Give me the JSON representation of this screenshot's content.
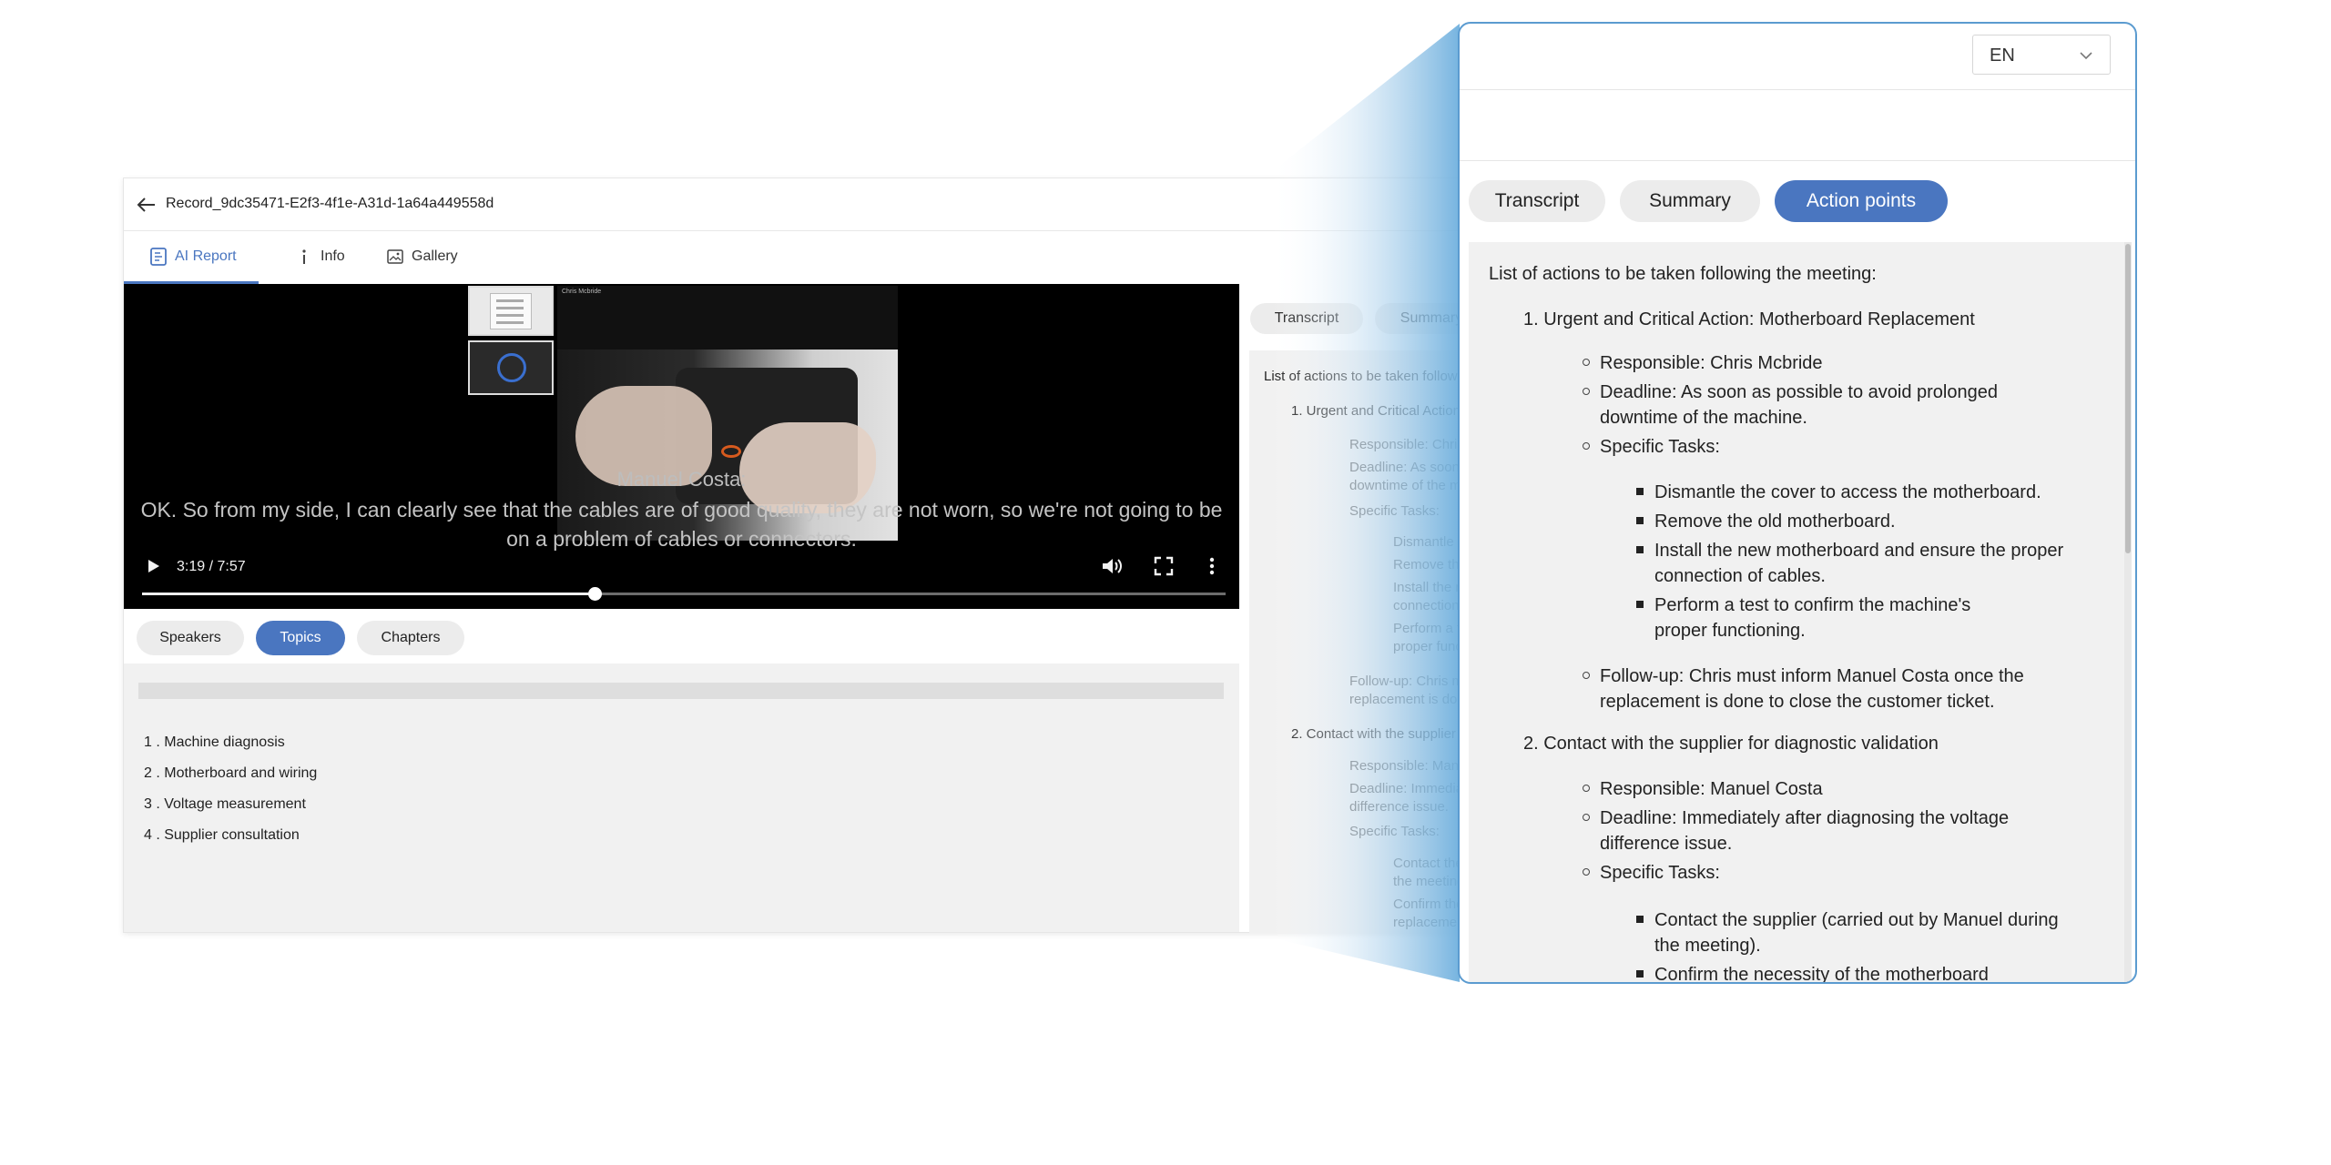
{
  "record": {
    "title": "Record_9dc35471-E2f3-4f1e-A31d-1a64a449558d"
  },
  "main_tabs": [
    {
      "label": "AI Report",
      "icon": "ai-report-icon",
      "active": true
    },
    {
      "label": "Info",
      "icon": "info-icon",
      "active": false
    },
    {
      "label": "Gallery",
      "icon": "image-icon",
      "active": false
    }
  ],
  "video": {
    "camera_label": "Chris Mcbride",
    "caption_speaker": "Manuel Costa:",
    "caption_text_1": "OK. So from my side, I can clearly see that the cables are of good quality, they are not worn, so we're not going to be",
    "caption_text_2": "on a problem of cables or connectors.",
    "time": "3:19 / 7:57",
    "progress": 0.4178
  },
  "sub_tabs": [
    {
      "label": "Speakers",
      "active": false
    },
    {
      "label": "Topics",
      "active": true
    },
    {
      "label": "Chapters",
      "active": false
    }
  ],
  "topics": [
    "1 . Machine diagnosis",
    "2 . Motherboard and wiring",
    "3 . Voltage measurement",
    "4 . Supplier consultation"
  ],
  "report_tabs": [
    {
      "label": "Transcript",
      "active": false
    },
    {
      "label": "Summary",
      "active": false
    },
    {
      "label": "Action points",
      "active": true
    }
  ],
  "language": {
    "selected": "EN"
  },
  "action_points": {
    "intro": "List of actions to be taken following the meeting:",
    "item1_title": "1. Urgent and Critical Action: Motherboard Replacement",
    "item1_responsible": "Responsible: Chris Mcbride",
    "item1_deadline_1": "Deadline: As soon as possible to avoid prolonged",
    "item1_deadline_2": "downtime of the machine.",
    "item1_tasks_label": "Specific Tasks:",
    "item1_task1": "Dismantle the cover to access the motherboard.",
    "item1_task2": "Remove the old motherboard.",
    "item1_task3_1": "Install the new motherboard and ensure the proper",
    "item1_task3_2": "connection of cables.",
    "item1_task4_1": "Perform a test to confirm the machine's",
    "item1_task4_2": "proper functioning.",
    "item1_followup_1": "Follow-up: Chris must inform Manuel Costa once the",
    "item1_followup_2": "replacement is done to close the customer ticket.",
    "item2_title": "2. Contact with the supplier for diagnostic validation",
    "item2_responsible": "Responsible: Manuel Costa",
    "item2_deadline_1": "Deadline: Immediately after diagnosing the voltage",
    "item2_deadline_2": "difference issue.",
    "item2_tasks_label": "Specific Tasks:",
    "item2_task1_1": "Contact the supplier (carried out by Manuel during",
    "item2_task1_2": "the meeting).",
    "item2_task2_1": "Confirm the necessity of the motherboard",
    "item2_task2_2": "replacement based on the diagnostic."
  },
  "colors": {
    "accent": "#4a76c0",
    "magnifier_border": "#5b9bd0",
    "panel_bg": "#f1f1f1"
  }
}
